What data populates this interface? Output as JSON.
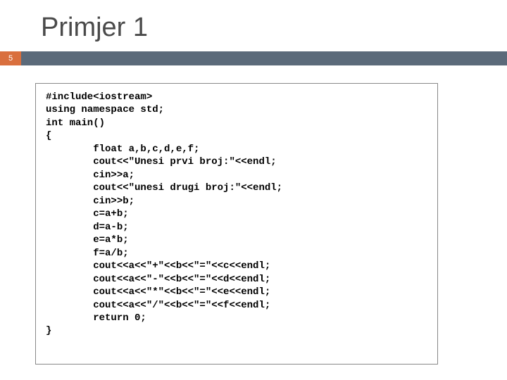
{
  "slide": {
    "title": "Primjer 1",
    "page_number": "5",
    "colors": {
      "accent_bar": "#5b6a7a",
      "page_badge": "#d96f3e"
    }
  },
  "code": {
    "l1": "#include<iostream>",
    "l2": "using namespace std;",
    "l3": "int main()",
    "l4": "{",
    "l5": "        float a,b,c,d,e,f;",
    "l6": "        cout<<\"Unesi prvi broj:\"<<endl;",
    "l7": "        cin>>a;",
    "l8": "        cout<<\"unesi drugi broj:\"<<endl;",
    "l9": "        cin>>b;",
    "l10": "        c=a+b;",
    "l11": "        d=a-b;",
    "l12": "        e=a*b;",
    "l13": "        f=a/b;",
    "l14": "        cout<<a<<\"+\"<<b<<\"=\"<<c<<endl;",
    "l15": "        cout<<a<<\"-\"<<b<<\"=\"<<d<<endl;",
    "l16": "        cout<<a<<\"*\"<<b<<\"=\"<<e<<endl;",
    "l17": "        cout<<a<<\"/\"<<b<<\"=\"<<f<<endl;",
    "l18": "        return 0;",
    "l19": "}"
  }
}
